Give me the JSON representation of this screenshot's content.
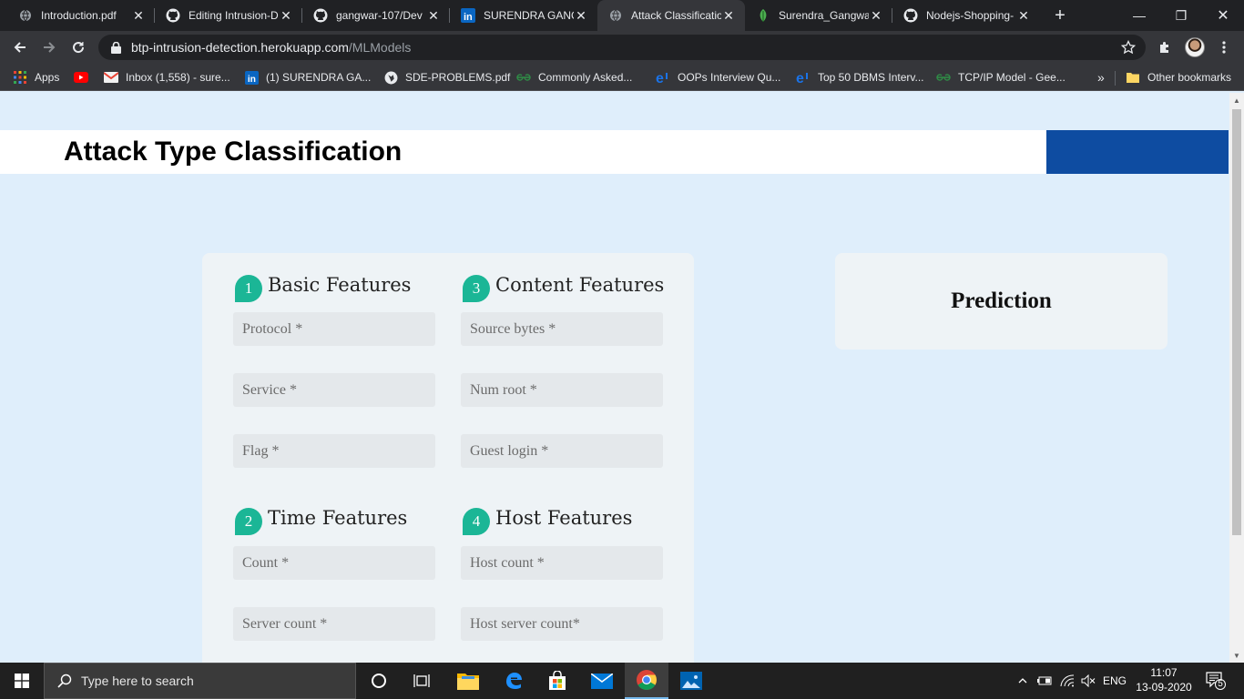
{
  "browser": {
    "tabs": [
      {
        "title": "Introduction.pdf",
        "icon": "globe-icon"
      },
      {
        "title": "Editing Intrusion-D",
        "icon": "github-icon"
      },
      {
        "title": "gangwar-107/Dev",
        "icon": "github-icon"
      },
      {
        "title": "SURENDRA GANG",
        "icon": "linkedin-icon"
      },
      {
        "title": "Attack Classificatio",
        "icon": "globe-icon",
        "active": true
      },
      {
        "title": "Surendra_Gangwa",
        "icon": "leaf-icon"
      },
      {
        "title": "Nodejs-Shopping-",
        "icon": "github-icon"
      }
    ],
    "url_host": "btp-intrusion-detection.herokuapp.com",
    "url_path": "/MLModels",
    "bookmarks": [
      {
        "label": "Apps",
        "icon": "apps-grid-icon"
      },
      {
        "label": "",
        "icon": "youtube-icon"
      },
      {
        "label": "Inbox (1,558) - sure...",
        "icon": "gmail-icon"
      },
      {
        "label": "(1) SURENDRA GA...",
        "icon": "linkedin-icon"
      },
      {
        "label": "SDE-PROBLEMS.pdf",
        "icon": "globe-icon"
      },
      {
        "label": "Commonly Asked...",
        "icon": "gfg-icon"
      },
      {
        "label": "OOPs Interview Qu...",
        "icon": "edureka-icon"
      },
      {
        "label": "Top 50 DBMS Interv...",
        "icon": "edureka-icon"
      },
      {
        "label": "TCP/IP Model - Gee...",
        "icon": "gfg-icon"
      }
    ],
    "overflow_label": "»",
    "other_bookmarks": "Other bookmarks"
  },
  "page": {
    "title": "Attack Type Classification",
    "sections": [
      {
        "num": "1",
        "title": "Basic Features",
        "fields": [
          "Protocol *",
          "Service *",
          "Flag *"
        ]
      },
      {
        "num": "3",
        "title": "Content Features",
        "fields": [
          "Source bytes *",
          "Num root *",
          "Guest login *"
        ]
      },
      {
        "num": "2",
        "title": "Time Features",
        "fields": [
          "Count *",
          "Server count *"
        ]
      },
      {
        "num": "4",
        "title": "Host Features",
        "fields": [
          "Host count *",
          "Host server count*"
        ]
      }
    ],
    "prediction_title": "Prediction"
  },
  "taskbar": {
    "search_placeholder": "Type here to search",
    "language": "ENG",
    "time": "11:07",
    "date": "13-09-2020",
    "notifications": "5"
  },
  "colors": {
    "accent_teal": "#1bb696",
    "header_blue": "#0e4ca1",
    "page_bg": "#dfeefb"
  }
}
